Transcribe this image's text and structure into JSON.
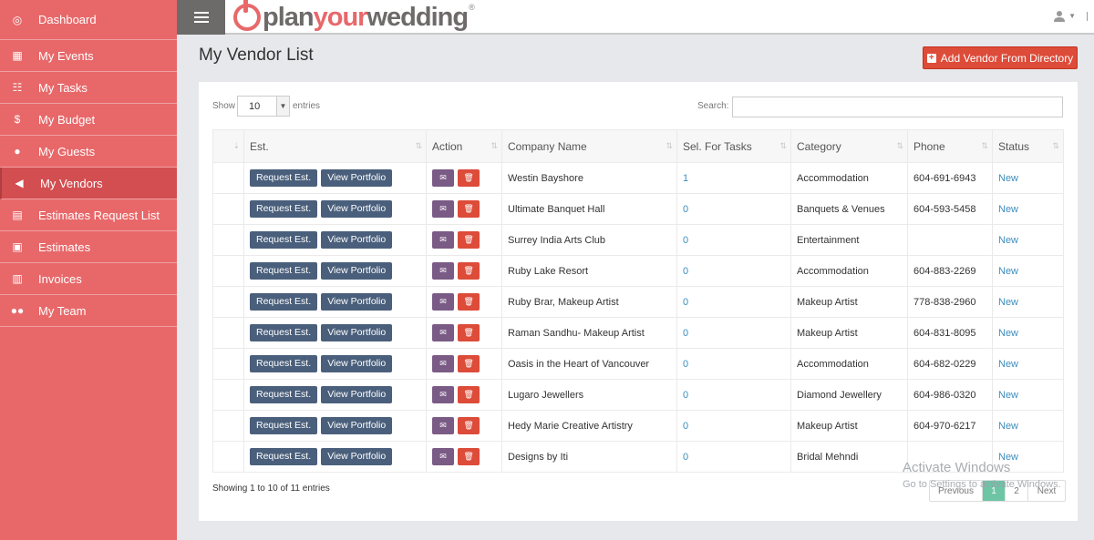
{
  "sidebar": {
    "items": [
      {
        "label": "Dashboard",
        "icon": "dashboard-icon",
        "glyph": "◎"
      },
      {
        "label": "My Events",
        "icon": "calendar-icon",
        "glyph": "▦"
      },
      {
        "label": "My Tasks",
        "icon": "tasks-icon",
        "glyph": "☷"
      },
      {
        "label": "My Budget",
        "icon": "dollar-icon",
        "glyph": "$"
      },
      {
        "label": "My Guests",
        "icon": "user-icon",
        "glyph": "●"
      },
      {
        "label": "My Vendors",
        "icon": "megaphone-icon",
        "glyph": "◀"
      },
      {
        "label": "Estimates Request List",
        "icon": "clipboard-icon",
        "glyph": "▤"
      },
      {
        "label": "Estimates",
        "icon": "clipboard-check-icon",
        "glyph": "▣"
      },
      {
        "label": "Invoices",
        "icon": "invoice-icon",
        "glyph": "▥"
      },
      {
        "label": "My Team",
        "icon": "team-icon",
        "glyph": "●●"
      }
    ]
  },
  "header": {
    "logo_part1": "plan",
    "logo_part2": "your",
    "logo_part3": "wedding",
    "logo_reg": "®",
    "user_icon": "user-icon"
  },
  "page": {
    "title": "My Vendor List",
    "add_button": "Add Vendor From Directory"
  },
  "table_controls": {
    "show_label": "Show",
    "show_value": "10",
    "entries_label": "entries",
    "search_label": "Search:"
  },
  "table": {
    "headers": [
      "",
      "Est.",
      "Action",
      "Company Name",
      "Sel. For Tasks",
      "Category",
      "Phone",
      "Status"
    ],
    "request_label": "Request Est.",
    "portfolio_label": "View Portfolio",
    "rows": [
      {
        "company": "Westin Bayshore",
        "tasks": "1",
        "category": "Accommodation",
        "phone": "604-691-6943",
        "status": "New"
      },
      {
        "company": "Ultimate Banquet Hall",
        "tasks": "0",
        "category": "Banquets & Venues",
        "phone": "604-593-5458",
        "status": "New"
      },
      {
        "company": "Surrey India Arts Club",
        "tasks": "0",
        "category": "Entertainment",
        "phone": "",
        "status": "New"
      },
      {
        "company": "Ruby Lake Resort",
        "tasks": "0",
        "category": "Accommodation",
        "phone": "604-883-2269",
        "status": "New"
      },
      {
        "company": "Ruby Brar, Makeup Artist",
        "tasks": "0",
        "category": "Makeup Artist",
        "phone": "778-838-2960",
        "status": "New"
      },
      {
        "company": "Raman Sandhu- Makeup Artist",
        "tasks": "0",
        "category": "Makeup Artist",
        "phone": "604-831-8095",
        "status": "New"
      },
      {
        "company": "Oasis in the Heart of Vancouver",
        "tasks": "0",
        "category": "Accommodation",
        "phone": "604-682-0229",
        "status": "New"
      },
      {
        "company": "Lugaro Jewellers",
        "tasks": "0",
        "category": "Diamond Jewellery",
        "phone": "604-986-0320",
        "status": "New"
      },
      {
        "company": "Hedy Marie Creative Artistry",
        "tasks": "0",
        "category": "Makeup Artist",
        "phone": "604-970-6217",
        "status": "New"
      },
      {
        "company": "Designs by Iti",
        "tasks": "0",
        "category": "Bridal Mehndi",
        "phone": "",
        "status": "New"
      }
    ]
  },
  "footer": {
    "info": "Showing 1 to 10 of 11 entries",
    "pagination": [
      "Previous",
      "1",
      "2",
      "Next"
    ],
    "active_page": "1"
  },
  "watermark": {
    "title": "Activate Windows",
    "subtitle": "Go to Settings to activate Windows."
  }
}
